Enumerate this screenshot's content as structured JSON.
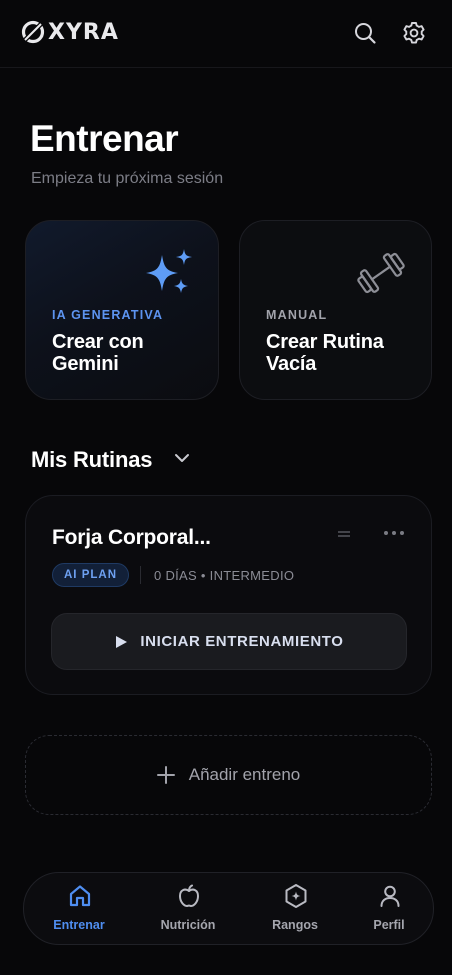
{
  "header": {
    "logo_text": "XYRA",
    "icons": [
      "search-icon",
      "gear-icon"
    ]
  },
  "page": {
    "title": "Entrenar",
    "subtitle": "Empieza tu próxima sesión"
  },
  "cards": [
    {
      "tag": "IA GENERATIVA",
      "label": "Crear con Gemini",
      "icon": "sparkles-icon"
    },
    {
      "tag": "MANUAL",
      "label": "Crear Rutina Vacía",
      "icon": "dumbbell-icon"
    }
  ],
  "section": {
    "title": "Mis Rutinas"
  },
  "routine": {
    "name": "Forja Corporal...",
    "badge": "AI PLAN",
    "meta": "0 DÍAS • INTERMEDIO",
    "start_label": "INICIAR ENTRENAMIENTO"
  },
  "add_button": {
    "label": "Añadir entreno"
  },
  "nav": [
    {
      "label": "Entrenar",
      "icon": "home-icon",
      "active": true
    },
    {
      "label": "Nutrición",
      "icon": "apple-icon",
      "active": false
    },
    {
      "label": "Rangos",
      "icon": "rank-icon",
      "active": false
    },
    {
      "label": "Perfil",
      "icon": "user-icon",
      "active": false
    }
  ],
  "colors": {
    "accent": "#4f8ef0",
    "background": "#070709",
    "badge_text": "#6ea1f2"
  }
}
